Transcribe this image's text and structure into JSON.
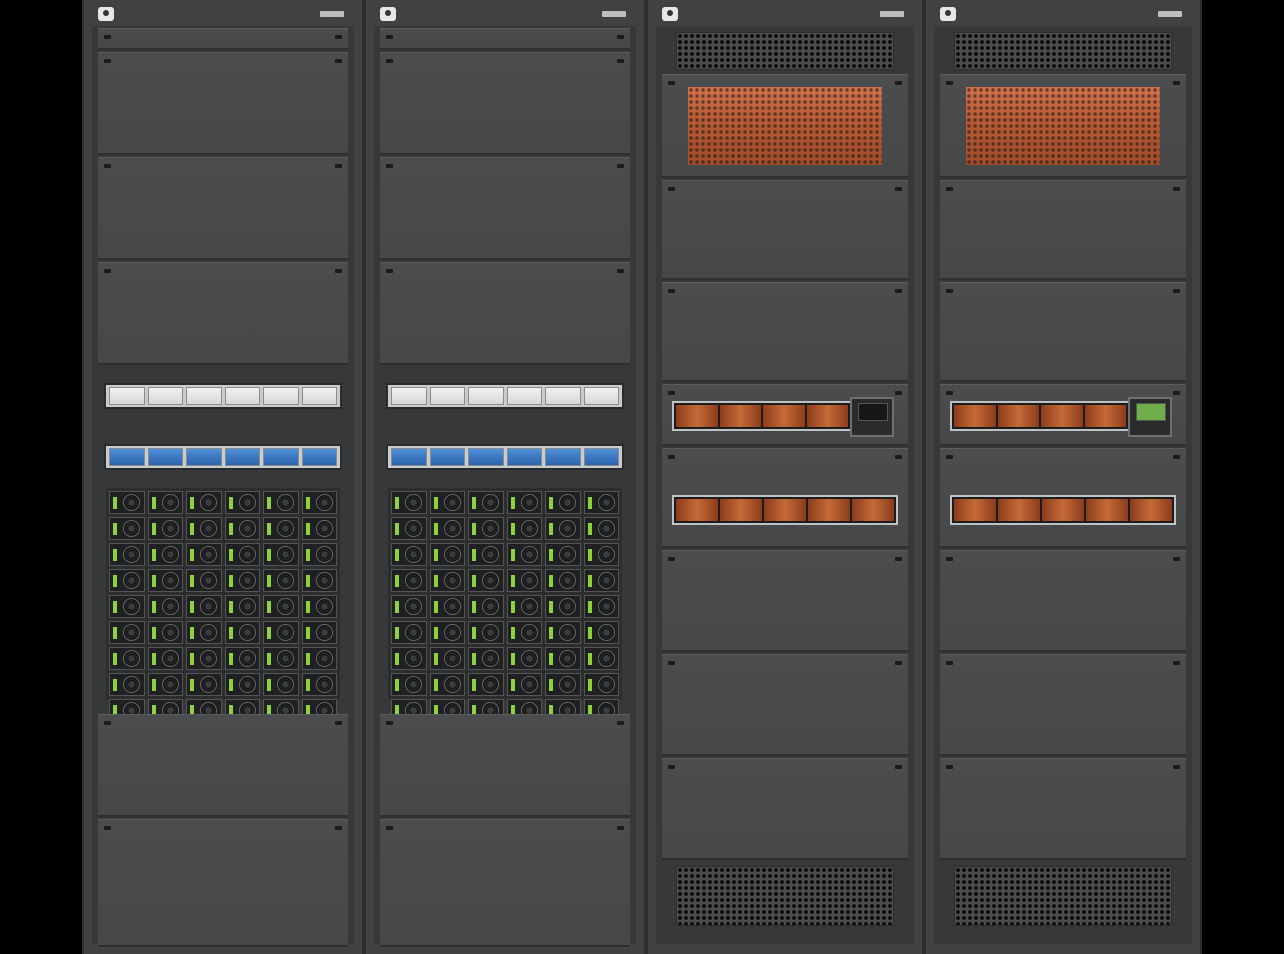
{
  "scene": {
    "description_type": "photograph",
    "colors": {
      "background": "#000000",
      "cabinet": "#3f4143",
      "panel": "#4a4c4e",
      "copper": "#c66a38",
      "led": "#8fd13a",
      "breaker_blue": "#2c63ad"
    }
  },
  "cabinets": [
    {
      "kind": "rectifier-cabinet",
      "breaker_rows": 2,
      "rectifier_rows": 9,
      "rectifier_columns": 6
    },
    {
      "kind": "rectifier-cabinet",
      "breaker_rows": 2,
      "rectifier_rows": 9,
      "rectifier_columns": 6
    },
    {
      "kind": "distribution-cabinet",
      "copper_windows": 2,
      "controller": "display"
    },
    {
      "kind": "distribution-cabinet",
      "copper_windows": 2,
      "controller": "green-display"
    }
  ],
  "icons": [
    "logo-icon",
    "fan-icon",
    "led-indicator-icon"
  ]
}
